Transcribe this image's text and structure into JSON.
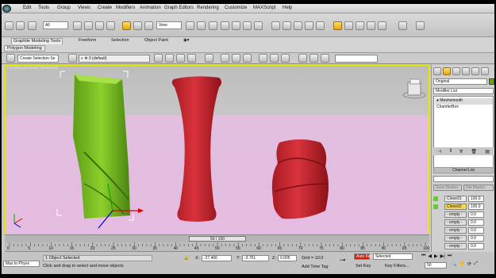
{
  "menu": [
    "Edit",
    "Tools",
    "Group",
    "Views",
    "Create",
    "Modifiers",
    "Animation",
    "Graph Editors",
    "Rendering",
    "Customize",
    "MAXScript",
    "Help"
  ],
  "toolbar": {
    "selection_filter": "All",
    "view_dropdown": "View"
  },
  "ribbon": {
    "tabs": [
      "Graphite Modeling Tools",
      "Freeform",
      "Selection",
      "Object Paint"
    ],
    "panel": "Polygon Modeling"
  },
  "toolbar2": {
    "selection_set": "Create Selection Se",
    "layer": "0 (default)"
  },
  "viewport": {
    "label": "[+] [Perspective] [Shaded]"
  },
  "command_panel": {
    "object_name": "Original",
    "modifier_list": "Modifier List",
    "stack": [
      "Meshsmooth",
      "ChamferBox"
    ],
    "channel_header": "Channel List",
    "buttons": [
      "Save Marker",
      "Del Marker"
    ],
    "channels": [
      {
        "name": "Clone01",
        "value": "100.0"
      },
      {
        "name": "Clone02",
        "value": "100.0"
      },
      {
        "name": "- empty -",
        "value": "0.0"
      },
      {
        "name": "- empty -",
        "value": "0.0"
      },
      {
        "name": "- empty -",
        "value": "0.0"
      },
      {
        "name": "- empty -",
        "value": "0.0"
      },
      {
        "name": "- empty -",
        "value": "0.0"
      }
    ]
  },
  "timeline": {
    "slider": "50 / 100",
    "ticks": [
      "0",
      "5",
      "10",
      "15",
      "20",
      "25",
      "30",
      "35",
      "40",
      "45",
      "50",
      "55",
      "60",
      "65",
      "70",
      "75",
      "80",
      "85",
      "90",
      "95",
      "100"
    ]
  },
  "status": {
    "max_to_physx": "Max to Physx",
    "selected": "1 Object Selected",
    "prompt": "Click and drag to select and move objects",
    "x": "-27.406",
    "y": "-3.761",
    "z": "0.005",
    "grid": "Grid = 10.0",
    "add_time_tag": "Add Time Tag",
    "auto_key": "Auto Key",
    "set_key": "Set Key",
    "key_mode": "Selected",
    "key_filters": "Key Filters...",
    "frame": "50"
  }
}
